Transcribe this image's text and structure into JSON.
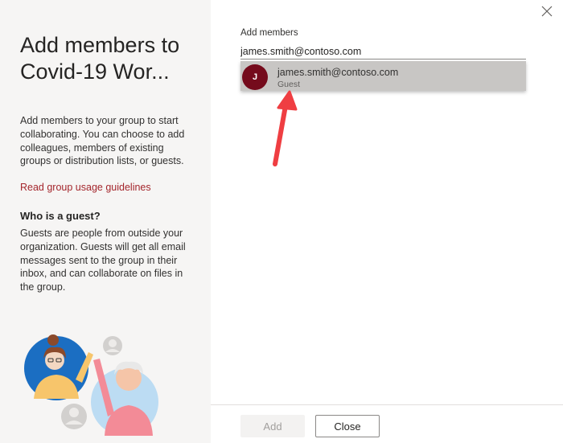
{
  "panel": {
    "title": "Add members to Covid-19 Wor...",
    "description": "Add members to your group to start collaborating. You can choose to add colleagues, members of existing groups or distribution lists, or guests.",
    "guidelines_link": "Read group usage guidelines",
    "guest_heading": "Who is a guest?",
    "guest_text": "Guests are people from outside your organization. Guests will get all email messages sent to the group in their inbox, and can collaborate on files in the group."
  },
  "form": {
    "label": "Add members",
    "value": "james.smith@contoso.com"
  },
  "suggestion": {
    "initial": "J",
    "email": "james.smith@contoso.com",
    "type": "Guest"
  },
  "footer": {
    "add_label": "Add",
    "close_label": "Close"
  },
  "colors": {
    "accent_link": "#a4262c",
    "avatar": "#750b1c",
    "arrow": "#ef3e42"
  }
}
